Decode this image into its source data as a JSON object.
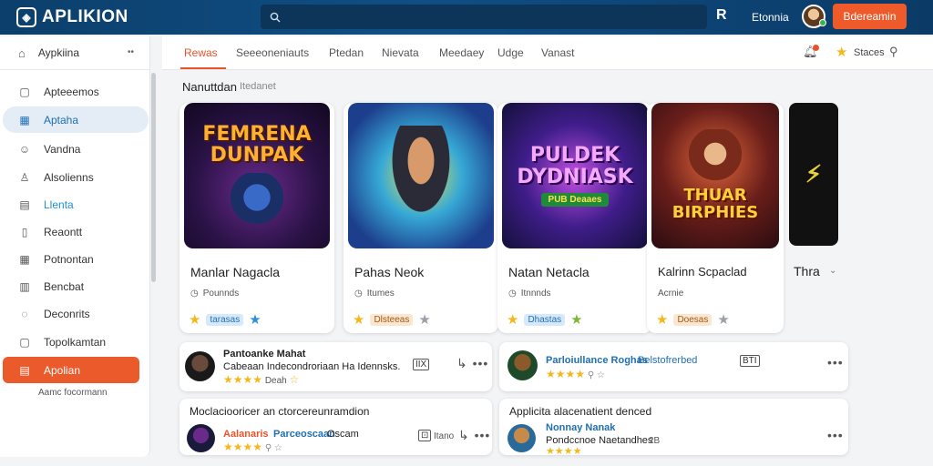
{
  "app": {
    "title": "APLIKION",
    "search_placeholder": "",
    "top_icon": "R",
    "user_name": "Etonnia",
    "top_button": "Bdereamin"
  },
  "sidebar": {
    "header": "Aypkiina",
    "items": [
      {
        "label": "Apteeemos",
        "icon": "square-icon"
      },
      {
        "label": "Aptaha",
        "icon": "chart-icon"
      },
      {
        "label": "Vandna",
        "icon": "smile-icon"
      },
      {
        "label": "Alsolienns",
        "icon": "user-icon"
      },
      {
        "label": "Llenta",
        "icon": "grid-icon"
      },
      {
        "label": "Reaontt",
        "icon": "doc-icon"
      },
      {
        "label": "Potnontan",
        "icon": "grid-icon"
      },
      {
        "label": "Bencbat",
        "icon": "chart-icon"
      },
      {
        "label": "Deconrits",
        "icon": "pin-icon"
      },
      {
        "label": "Topolkamtan",
        "icon": "doc-icon"
      },
      {
        "label": "Apolian",
        "icon": "list-icon"
      }
    ],
    "footer": "Aamc focormann"
  },
  "tabs": [
    "Rewas",
    "Seeeoneniauts",
    "Ptedan",
    "Nievata",
    "Meedaey",
    "Udge",
    "Vanast"
  ],
  "toolbar_right": {
    "label": "Staces"
  },
  "section": {
    "title": "Nanuttdan",
    "subtitle": "Itedanet"
  },
  "cards": [
    {
      "art_title": "FEMRENA\nDUNPAK",
      "name": "Manlar Nagacla",
      "sub": "Pounnds",
      "rating": "tarasas"
    },
    {
      "art_title": "",
      "name": "Pahas Neok",
      "sub": "Itumes",
      "rating": "Dlsteeas"
    },
    {
      "art_title": "PULDEK\nDYDNIASK",
      "art_banner": "PUB Deaaes",
      "name": "Natan Netacla",
      "sub": "Itnnnds",
      "rating": "Dhastas"
    },
    {
      "art_title": "THUAR\nBIRPHIES",
      "name": "Kalrinn Scpaclad",
      "sub": "Acrnie",
      "rating": "Doesas"
    }
  ],
  "card_partial": {
    "name": "Thra"
  },
  "list": [
    {
      "title": "Pantoanke Mahat",
      "desc": "Cabeaan Indecondroriaan Ha Idennsks.",
      "tag": "Deah",
      "badge": "IIX"
    },
    {
      "title": "Parloiullance Roghas",
      "desc": "Belstofrerbed",
      "badge": "BTI"
    },
    {
      "title": "Moclaciooricer an ctorcereunramdion",
      "name": "Aalanaris",
      "name2": "Parceoscaan",
      "extra": "Oscam",
      "badge": "Itano"
    },
    {
      "title": "Applicita alacenatient denced",
      "name": "Nonnay Nanak",
      "desc": "Pondccnoe Naetandhes",
      "badge": "2B"
    }
  ]
}
